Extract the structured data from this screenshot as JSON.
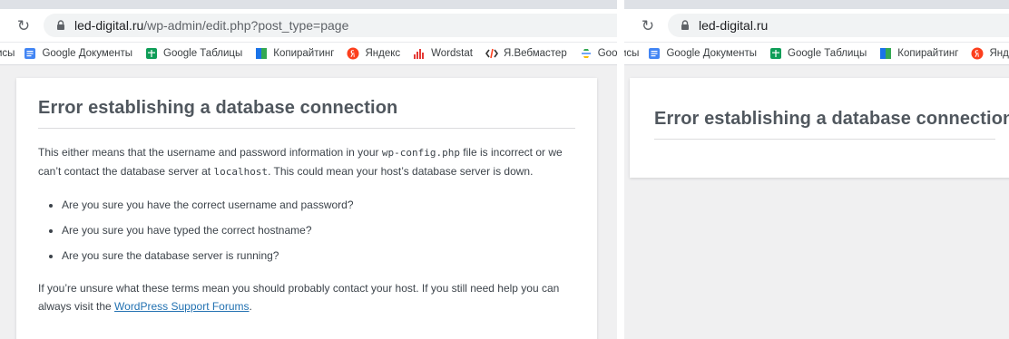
{
  "left_window": {
    "url_host": "led-digital.ru",
    "url_path": "/wp-admin/edit.php?post_type=page",
    "bookmarks": [
      {
        "label": "исы",
        "icon": "cut-off"
      },
      {
        "label": "Google Документы",
        "icon": "google-docs-icon",
        "color": "#4285f4"
      },
      {
        "label": "Google Таблицы",
        "icon": "google-sheets-icon",
        "color": "#0f9d58"
      },
      {
        "label": "Копирайтинг",
        "icon": "folder-icon",
        "color": "#1a73e8"
      },
      {
        "label": "Яндекс",
        "icon": "yandex-icon",
        "color": "#fc3f1d"
      },
      {
        "label": "Wordstat",
        "icon": "wordstat-icon",
        "color": "#e53935"
      },
      {
        "label": "Я.Вебмастер",
        "icon": "webmaster-icon",
        "color": "#333333"
      },
      {
        "label": "Google S",
        "icon": "google-search-console-icon",
        "color": "#4285f4"
      }
    ],
    "error": {
      "title": "Error establishing a database connection",
      "p1_before": "This either means that the username and password information in your ",
      "p1_code1": "wp-config.php",
      "p1_mid": " file is incorrect or we can’t contact the database server at ",
      "p1_code2": "localhost",
      "p1_after": ". This could mean your host’s database server is down.",
      "bullets": [
        "Are you sure you have the correct username and password?",
        "Are you sure you have typed the correct hostname?",
        "Are you sure the database server is running?"
      ],
      "p2_before": "If you’re unsure what these terms mean you should probably contact your host. If you still need help you can always visit the ",
      "p2_link": "WordPress Support Forums",
      "p2_after": "."
    }
  },
  "right_window": {
    "url_host": "led-digital.ru",
    "bookmarks": [
      {
        "label": "исы"
      },
      {
        "label": "Google Документы"
      },
      {
        "label": "Google Таблицы"
      },
      {
        "label": "Копирайтинг"
      },
      {
        "label": "Яндекс"
      }
    ],
    "error_title": "Error establishing a database connection"
  }
}
